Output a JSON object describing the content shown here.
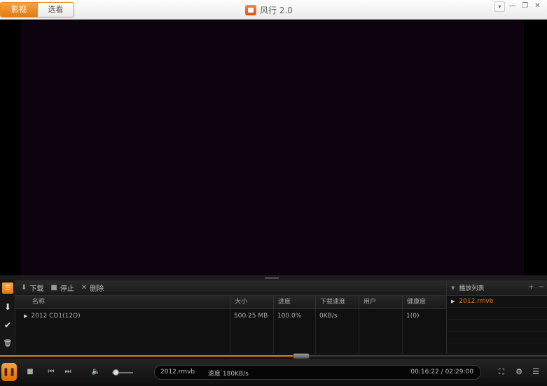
{
  "titlebar": {
    "tabs": [
      {
        "label": "影视",
        "active": true
      },
      {
        "label": "选看",
        "active": false
      }
    ],
    "app_title": "风行 2.0",
    "window_controls": {
      "menu": "▾",
      "minimize": "—",
      "restore": "❐",
      "close": "✕"
    }
  },
  "colors": {
    "accent": "#e07b12",
    "video_bg": "#0c030e",
    "panel_bg": "#101010"
  },
  "download_toolbar": {
    "download_label": "下载",
    "stop_label": "停止",
    "delete_label": "删除"
  },
  "download_table": {
    "columns": [
      "名称",
      "大小",
      "进度",
      "下载速度",
      "用户",
      "健康度"
    ],
    "rows": [
      {
        "name": "2012 CD1(12O)",
        "size": "500.25 MB",
        "progress": "100.0%",
        "speed": "0KB/s",
        "users": "",
        "health": "1(0)"
      }
    ]
  },
  "playlist": {
    "title": "播放列表",
    "add": "+",
    "remove": "−",
    "items": [
      "2012.rmvb"
    ]
  },
  "playback": {
    "progress_fraction": 0.55,
    "volume_fraction": 0.15,
    "current_file": "2012.rmvb",
    "speed_text": "速度 180KB/s",
    "time_text": "00:16:22 / 02:29:00"
  },
  "icons": {
    "side_list": "☰",
    "side_download": "⬇",
    "side_done": "✔",
    "side_trash": "🗑",
    "tool_download": "⬇",
    "tool_stop": "■",
    "tool_delete": "✕",
    "pause": "❚❚",
    "stop": "■",
    "prev": "⏮",
    "next": "⏭",
    "volume": "🔈",
    "fullscreen": "⛶",
    "settings": "⚙",
    "list": "☰",
    "expander": "▶"
  }
}
